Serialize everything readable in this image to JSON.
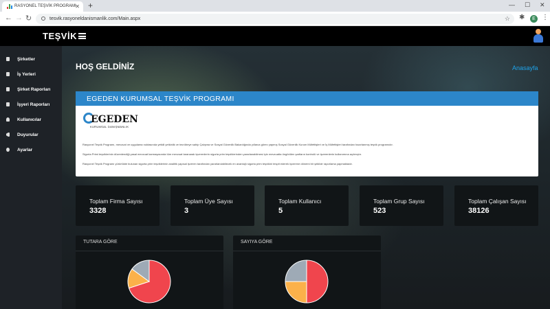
{
  "browser": {
    "tab_title": "RASYONEL TEŞVİK PROGRAMI",
    "url": "tesvik.rasyoneldanismanlik.com/Main.aspx",
    "profile_initial": "E"
  },
  "header": {
    "brand": "TEŞVİK"
  },
  "sidebar": {
    "items": [
      {
        "label": "Şirketler"
      },
      {
        "label": "İş Yerleri"
      },
      {
        "label": "Şirket Raporları"
      },
      {
        "label": "İşyeri Raporları"
      },
      {
        "label": "Kullanıcılar"
      },
      {
        "label": "Duyurular"
      },
      {
        "label": "Ayarlar"
      }
    ]
  },
  "main": {
    "welcome": "HOŞ GELDİNİZ",
    "home_link": "Anasayfa",
    "info": {
      "title": "EGEDEN KURUMSAL TEŞVİK PROGRAMI",
      "logo_word": "EGEDEN",
      "logo_sub": "KURUMSAL DANIŞMANLIK",
      "paragraphs": [
        "Rasyonel Teşvik Programı, mevzuat ve uygulama noktasında yetkili yetkinlik ve tecrübeye sahip Çalışma ve Sosyal Güvenlik Bakanlığında yıllarca görev yapmış Sosyal Güvenlik Kurum Müfettişleri ve İş Müfettişleri tarafından hazırlanmış teşvik programıdır.",
        "Sigorta Primi teşviklerinin düzenlendiği yasal mevzuat karmaşasında tüm mevzuat taranarak işverenlerin sigorta prim teşviklerinden yararlanabilmesi için mevzuatta öngörülen şartların kontrolü ve işverenlerin kullanımına açılmıştır.",
        "Rasyonel Teşvik Programı yürürlükte bulunan sigorta prim teşviklerinin analitik yapısal işveren tarafından yararlanılabilecek en avantajlı sigorta prim teşvikini tespit ederek işverene dönemi bir şekilde raporlama yapmaktadır."
      ]
    },
    "stats": [
      {
        "label": "Toplam Firma Sayısı",
        "value": "3328"
      },
      {
        "label": "Toplam Üye Sayısı",
        "value": "3"
      },
      {
        "label": "Toplam Kullanıcı",
        "value": "5"
      },
      {
        "label": "Toplam Grup Sayısı",
        "value": "523"
      },
      {
        "label": "Toplam Çalışan Sayısı",
        "value": "38126"
      }
    ],
    "panels": [
      {
        "title": "TUTARA GÖRE"
      },
      {
        "title": "SAYIYA GÖRE"
      }
    ]
  },
  "chart_data": [
    {
      "type": "pie",
      "title": "TUTARA GÖRE",
      "slices": [
        {
          "value": 70,
          "color": "#f0454d"
        },
        {
          "value": 15,
          "color": "#fbb14a"
        },
        {
          "value": 15,
          "color": "#9eaab6"
        }
      ]
    },
    {
      "type": "pie",
      "title": "SAYIYA GÖRE",
      "slices": [
        {
          "value": 50,
          "color": "#f0454d"
        },
        {
          "value": 25,
          "color": "#fbb14a"
        },
        {
          "value": 25,
          "color": "#9eaab6"
        }
      ]
    }
  ]
}
